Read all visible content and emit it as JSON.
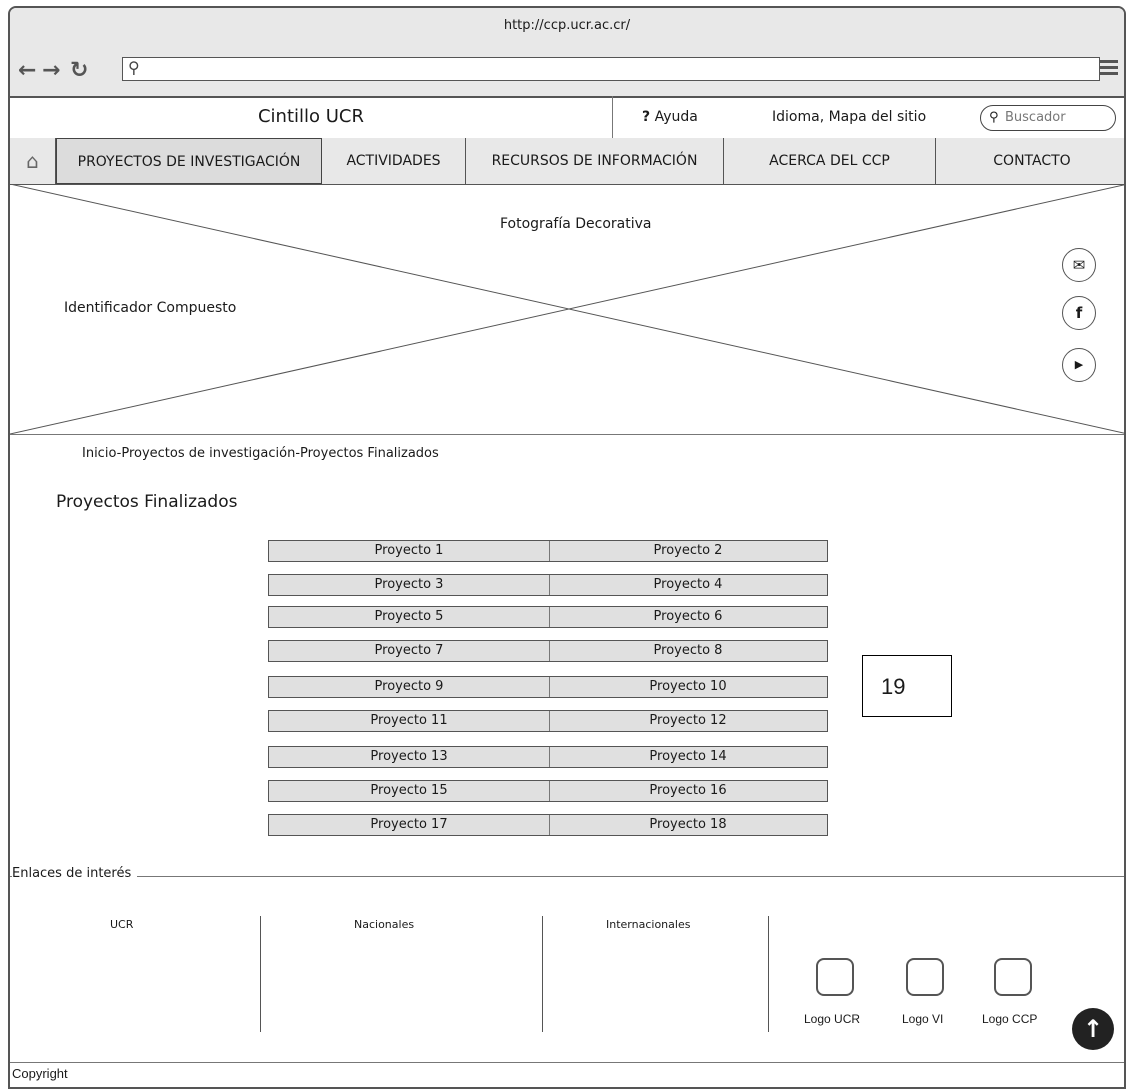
{
  "browser": {
    "url": "http://ccp.ucr.ac.cr/",
    "back_icon": "arrow-left-icon",
    "forward_icon": "arrow-right-icon",
    "reload_icon": "reload-icon",
    "menu_icon": "hamburger-icon"
  },
  "header": {
    "cintillo": "Cintillo UCR",
    "help": "Ayuda",
    "language_sitemap": "Idioma, Mapa del sitio",
    "search_placeholder": "Buscador"
  },
  "menu": {
    "items": [
      {
        "label": "PROYECTOS DE INVESTIGACIÓN",
        "active": true
      },
      {
        "label": "ACTIVIDADES"
      },
      {
        "label": "RECURSOS DE INFORMACIÓN"
      },
      {
        "label": "ACERCA DEL CCP"
      },
      {
        "label": "CONTACTO"
      }
    ]
  },
  "hero": {
    "caption": "Fotografía Decorativa",
    "identifier": "Identificador Compuesto",
    "social_icons": [
      "email-icon",
      "facebook-icon",
      "youtube-icon"
    ]
  },
  "breadcrumb": "Inicio-Proyectos de investigación-Proyectos Finalizados",
  "page_title": "Proyectos Finalizados",
  "projects": [
    [
      "Proyecto 1",
      "Proyecto 2"
    ],
    [
      "Proyecto 3",
      "Proyecto 4"
    ],
    [
      "Proyecto 5",
      "Proyecto 6"
    ],
    [
      "Proyecto 7",
      "Proyecto 8"
    ],
    [
      "Proyecto 9",
      "Proyecto 10"
    ],
    [
      "Proyecto 11",
      "Proyecto 12"
    ],
    [
      "Proyecto 13",
      "Proyecto 14"
    ],
    [
      "Proyecto 15",
      "Proyecto 16"
    ],
    [
      "Proyecto 17",
      "Proyecto 18"
    ]
  ],
  "annotation_badge": "19",
  "links": {
    "title": "Enlaces de interés",
    "columns": [
      "UCR",
      "Nacionales",
      "Internacionales"
    ],
    "logos": [
      "Logo UCR",
      "Logo VI",
      "Logo CCP"
    ]
  },
  "footer": {
    "copyright": "Copyright"
  }
}
